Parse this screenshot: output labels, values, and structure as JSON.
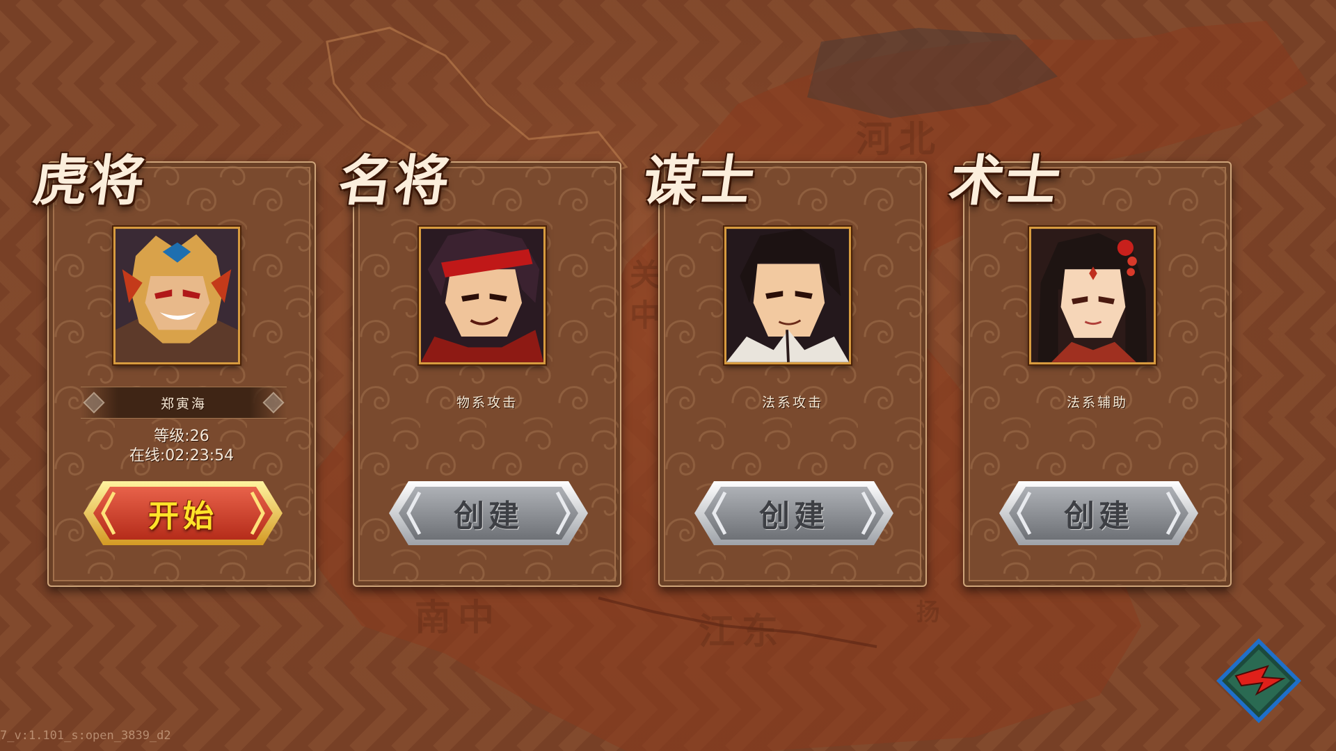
{
  "background": {
    "regions": [
      "河北",
      "南中",
      "江东",
      "关中",
      "扬"
    ]
  },
  "cards": [
    {
      "title": "虎将",
      "character_name": "郑寅海",
      "level_text": "等级:26",
      "online_text": "在线:02:23:54",
      "button_label": "开始",
      "button_type": "start"
    },
    {
      "title": "名将",
      "role_text": "物系攻击",
      "button_label": "创建",
      "button_type": "create"
    },
    {
      "title": "谋士",
      "role_text": "法系攻击",
      "button_label": "创建",
      "button_type": "create"
    },
    {
      "title": "术士",
      "role_text": "法系辅助",
      "button_label": "创建",
      "button_type": "create"
    }
  ],
  "version": "7_v:1.101_s:open_3839_d2",
  "corner_button_icon": "red-flag-diamond-icon",
  "colors": {
    "start_button": "#d0422a",
    "create_button": "#8a8d92",
    "card_border": "#cfa57a",
    "title_text": "#fbeedc",
    "start_label": "#ffe42a"
  }
}
